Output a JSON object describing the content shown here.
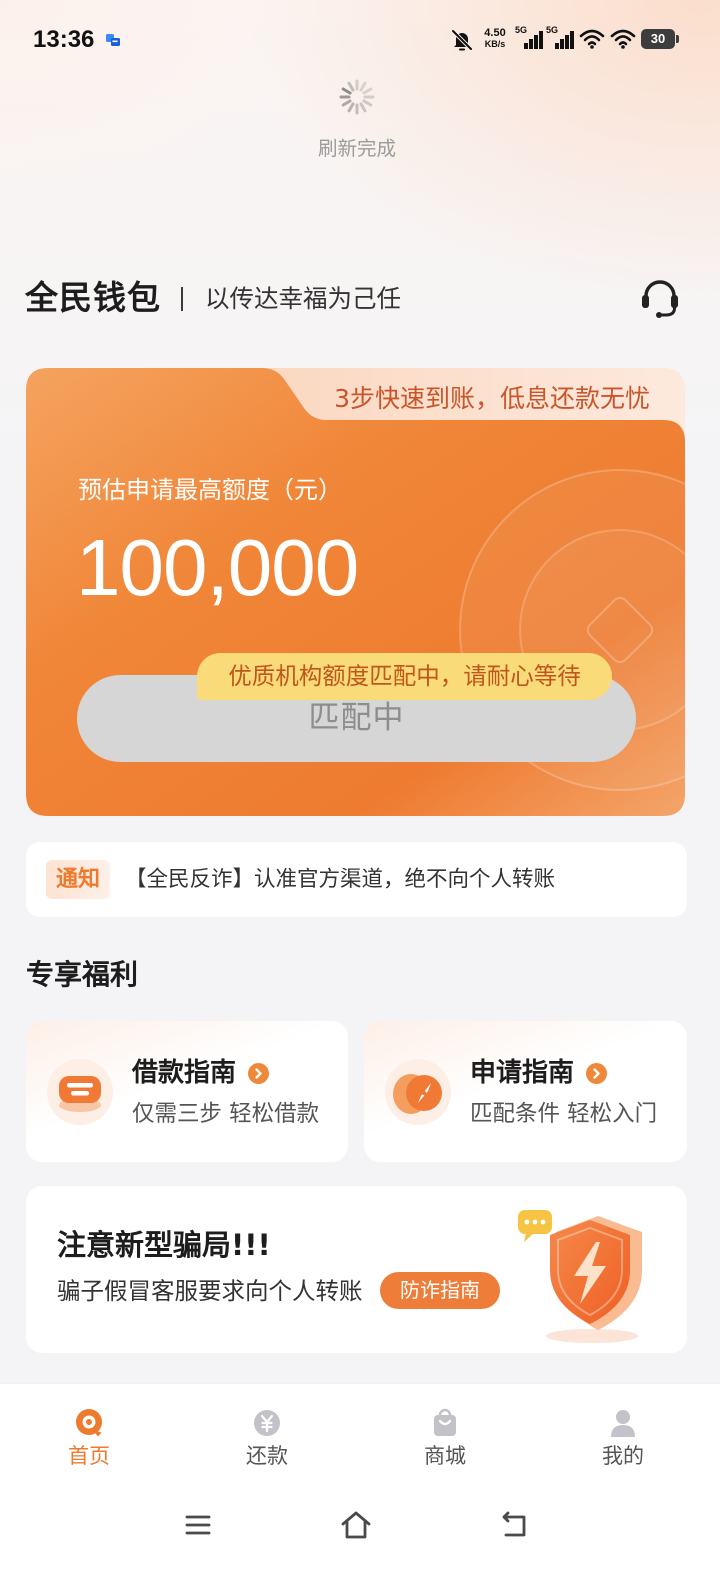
{
  "status_bar": {
    "time": "13:36",
    "net_speed": "4.50",
    "net_speed_unit": "KB/s",
    "sim1_network": "5G",
    "sim2_network": "5G",
    "battery_level": "30"
  },
  "refresh": {
    "status_text": "刷新完成"
  },
  "header": {
    "brand": "全民钱包",
    "slogan": "以传达幸福为己任",
    "support_icon": "headset-icon"
  },
  "credit_card": {
    "promo_tab": "3步快速到账，低息还款无忧",
    "limit_label": "预估申请最高额度（元）",
    "limit_amount": "100,000",
    "matching_tip": "优质机构额度匹配中，请耐心等待",
    "action_button": "匹配中"
  },
  "notice": {
    "badge": "通知",
    "message": "【全民反诈】认准官方渠道，绝不向个人转账"
  },
  "benefits": {
    "section_title": "专享福利",
    "cards": [
      {
        "title": "借款指南",
        "subtitle": "仅需三步 轻松借款",
        "icon": "loan-guide-icon"
      },
      {
        "title": "申请指南",
        "subtitle": "匹配条件 轻松入门",
        "icon": "apply-guide-icon"
      }
    ]
  },
  "scam_alert": {
    "title": "注意新型骗局!!!",
    "message": "骗子假冒客服要求向个人转账",
    "button": "防诈指南",
    "illustration": "shield-icon"
  },
  "bottom_nav": {
    "items": [
      {
        "label": "首页",
        "icon": "home-icon",
        "active": true
      },
      {
        "label": "还款",
        "icon": "repay-icon",
        "active": false
      },
      {
        "label": "商城",
        "icon": "shop-icon",
        "active": false
      },
      {
        "label": "我的",
        "icon": "profile-icon",
        "active": false
      }
    ]
  },
  "system_nav": {
    "icons": [
      "menu-icon",
      "home-outline-icon",
      "back-icon"
    ]
  },
  "colors": {
    "accent": "#EE7A2D",
    "card_orange": "#F0843A",
    "tooltip_yellow": "#FADB7A",
    "button_disabled": "#D6D6D6",
    "page_bg": "#F4F4F6"
  }
}
